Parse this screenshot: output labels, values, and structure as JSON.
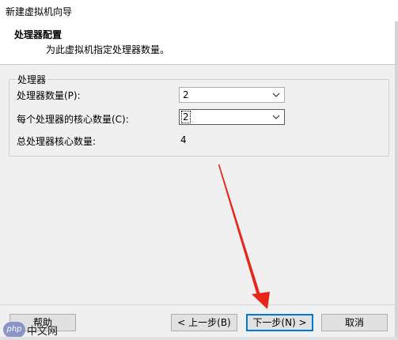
{
  "window": {
    "title": "新建虚拟机向导"
  },
  "header": {
    "title": "处理器配置",
    "subtitle": "为此虚拟机指定处理器数量。"
  },
  "processor_group": {
    "legend": "处理器",
    "processor_count_label": "处理器数量(P):",
    "processor_count_value": "2",
    "cores_per_processor_label": "每个处理器的核心数量(C):",
    "cores_per_processor_value": "2",
    "total_cores_label": "总处理器核心数量:",
    "total_cores_value": "4"
  },
  "buttons": {
    "help": "帮助",
    "back": "< 上一步(B)",
    "next": "下一步(N) >",
    "cancel": "取消"
  },
  "watermark": {
    "logo": "php",
    "text": "中文网"
  },
  "colors": {
    "annotation_arrow": "#e8251a",
    "focus_border": "#0078d7"
  }
}
